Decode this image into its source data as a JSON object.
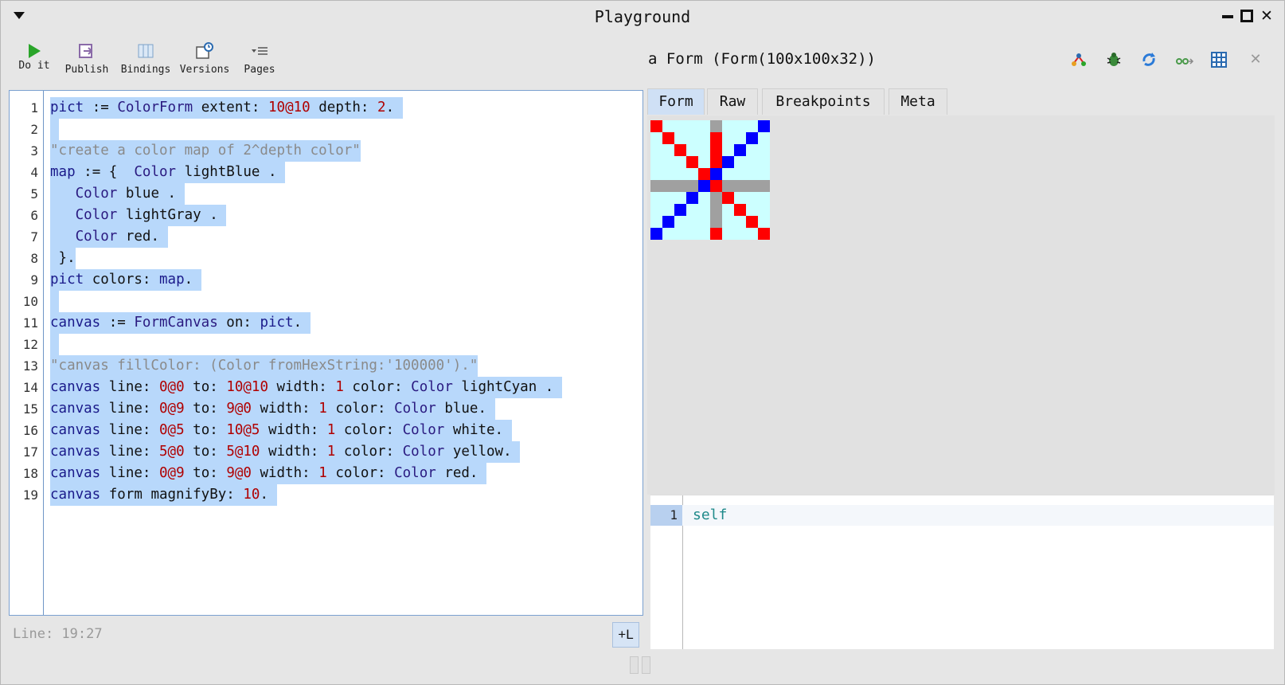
{
  "window": {
    "title": "Playground"
  },
  "toolbar": {
    "do_it": "Do it",
    "publish": "Publish",
    "bindings": "Bindings",
    "versions": "Versions",
    "pages": "Pages"
  },
  "editor": {
    "lines": [
      {
        "n": "1"
      },
      {
        "n": "2"
      },
      {
        "n": "3"
      },
      {
        "n": "4"
      },
      {
        "n": "5"
      },
      {
        "n": "6"
      },
      {
        "n": "7"
      },
      {
        "n": "8"
      },
      {
        "n": "9"
      },
      {
        "n": "10"
      },
      {
        "n": "11"
      },
      {
        "n": "12"
      },
      {
        "n": "13"
      },
      {
        "n": "14"
      },
      {
        "n": "15"
      },
      {
        "n": "16"
      },
      {
        "n": "17"
      },
      {
        "n": "18"
      },
      {
        "n": "19"
      }
    ],
    "status": "Line: 19:27",
    "add_line_button": "+L"
  },
  "inspector": {
    "title": "a Form (Form(100x100x32))",
    "tabs": [
      "Form",
      "Raw",
      "Breakpoints",
      "Meta"
    ],
    "active_tab": "Form",
    "mini_editor": {
      "line_number": "1",
      "code": "self"
    },
    "pixel_colors": {
      "cyan": "#ccffff",
      "red": "#ff0000",
      "blue": "#0000ff",
      "gray": "#a0a0a0"
    }
  },
  "colors": {
    "accent": "#b8d8fb",
    "run_green": "#2aa52a"
  }
}
